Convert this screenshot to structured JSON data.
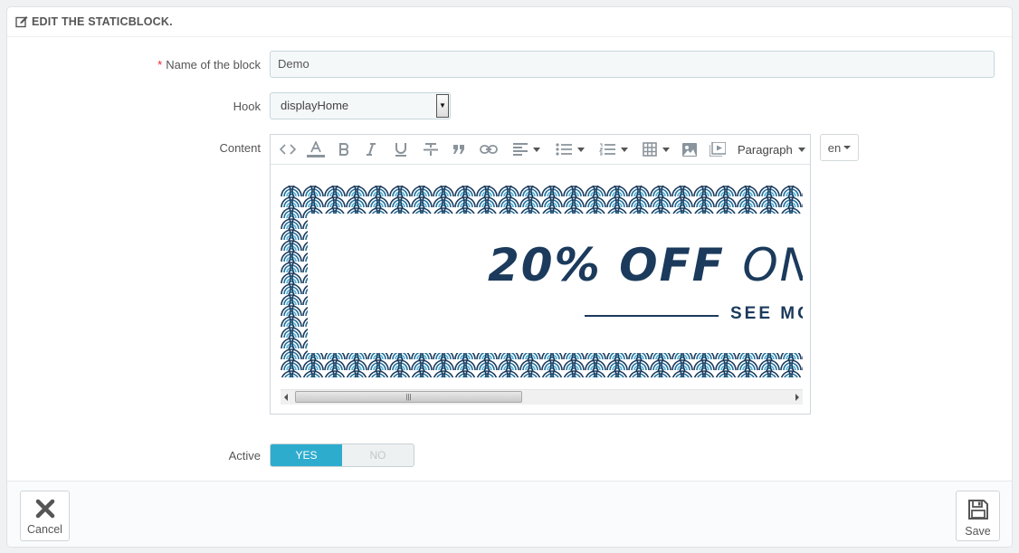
{
  "header": {
    "title": "EDIT THE STATICBLOCK."
  },
  "form": {
    "name": {
      "label": "Name of the block",
      "required_mark": "*",
      "value": "Demo"
    },
    "hook": {
      "label": "Hook",
      "value": "displayHome"
    },
    "content": {
      "label": "Content",
      "toolbar": {
        "items": [
          "code-icon",
          "text-color-icon",
          "bold-icon",
          "italic-icon",
          "underline-icon",
          "strikethrough-icon",
          "blockquote-icon",
          "link-icon",
          "align-icon",
          "bullet-list-icon",
          "numbered-list-icon",
          "table-icon",
          "image-icon",
          "media-icon"
        ],
        "format_label": "Paragraph"
      },
      "banner": {
        "promo_bold": "20% OFF",
        "promo_thin": "ON",
        "see_more": "SEE MO"
      },
      "colors": {
        "pattern_dark": "#1b3a5c",
        "pattern_mid": "#1f6e9a",
        "pattern_light": "#4db3d9"
      }
    },
    "language": {
      "value": "en"
    },
    "active": {
      "label": "Active",
      "yes": "YES",
      "no": "NO",
      "selected": "YES"
    }
  },
  "footer": {
    "cancel_label": "Cancel",
    "save_label": "Save"
  },
  "colors": {
    "accent": "#2eacce",
    "required": "#e22222"
  }
}
